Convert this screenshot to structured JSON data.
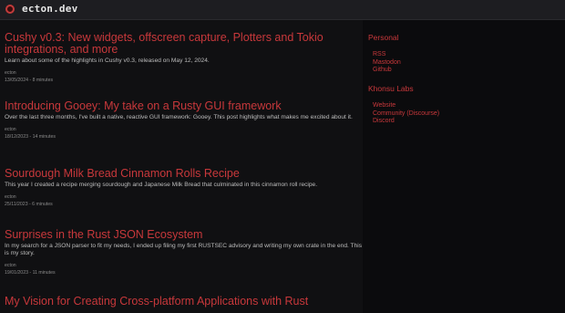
{
  "header": {
    "site_name": "ecton.dev"
  },
  "posts": [
    {
      "title": "Cushy v0.3: New widgets, offscreen capture, Plotters and Tokio integrations, and more",
      "summary": "Learn about some of the highlights in Cushy v0.3, released on May 12, 2024.",
      "author": "ecton",
      "meta": "13/05/2024 - 8 minutes"
    },
    {
      "title": "Introducing Gooey: My take on a Rusty GUI framework",
      "summary": "Over the last three months, I've built a native, reactive GUI framework: Gooey. This post highlights what makes me excited about it.",
      "author": "ecton",
      "meta": "18/12/2023 - 14 minutes"
    },
    {
      "title": "Sourdough Milk Bread Cinnamon Rolls Recipe",
      "summary": "This year I created a recipe merging sourdough and Japanese Milk Bread that culminated in this cinnamon roll recipe.",
      "author": "ecton",
      "meta": "25/11/2023 - 6 minutes"
    },
    {
      "title": "Surprises in the Rust JSON Ecosystem",
      "summary": "In my search for a JSON parser to fit my needs, I ended up filing my first RUSTSEC advisory and writing my own crate in the end. This is my story.",
      "author": "ecton",
      "meta": "19/01/2023 - 11 minutes"
    },
    {
      "title": "My Vision for Creating Cross-platform Applications with Rust",
      "summary": "",
      "author": "",
      "meta": ""
    }
  ],
  "sidebar": {
    "personal": {
      "heading": "Personal",
      "links": [
        "RSS",
        "Mastodon",
        "Github"
      ]
    },
    "khonsu": {
      "heading": "Khonsu Labs",
      "links": [
        "Website",
        "Community (Discourse)",
        "Discord"
      ]
    }
  }
}
